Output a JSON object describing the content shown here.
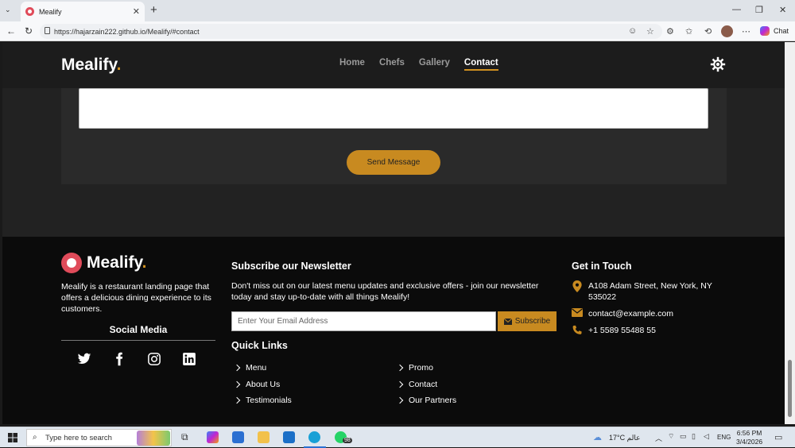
{
  "browser": {
    "tab_title": "Mealify",
    "url": "https://hajarzain222.github.io/Mealify/#contact",
    "chat_label": "Chat"
  },
  "site": {
    "brand": "Mealify",
    "brand_dot": ".",
    "nav": [
      "Home",
      "Chefs",
      "Gallery",
      "Contact"
    ],
    "active_nav": "Contact"
  },
  "contact": {
    "send_label": "Send Message"
  },
  "footer": {
    "brand": "Mealify",
    "brand_dot": ".",
    "description": "Mealify is a restaurant landing page that offers a delicious dining experience to its customers.",
    "social_title": "Social Media",
    "social_icons": [
      "twitter-icon",
      "facebook-icon",
      "instagram-icon",
      "linkedin-icon"
    ],
    "newsletter_title": "Subscribe our Newsletter",
    "newsletter_text": "Don't miss out on our latest menu updates and exclusive offers - join our newsletter today and stay up-to-date with all things Mealify!",
    "email_placeholder": "Enter Your Email Address",
    "subscribe_label": "Subscribe",
    "quick_links_title": "Quick Links",
    "quick_links": [
      "Menu",
      "Promo",
      "About Us",
      "Contact",
      "Testimonials",
      "Our Partners"
    ],
    "get_in_touch_title": "Get in Touch",
    "address": "A108 Adam Street, New York, NY 535022",
    "email": "contact@example.com",
    "phone": "+1 5589 55488 55"
  },
  "taskbar": {
    "search_placeholder": "Type here to search",
    "whatsapp_badge": "98",
    "weather": "17°C  عالم",
    "lang": "ENG",
    "time": "6:56 PM",
    "date": "3/4/2026"
  },
  "colors": {
    "accent": "#c88a20",
    "footer_bg": "#0b0b0b",
    "header_bg": "#1c1c1c"
  }
}
